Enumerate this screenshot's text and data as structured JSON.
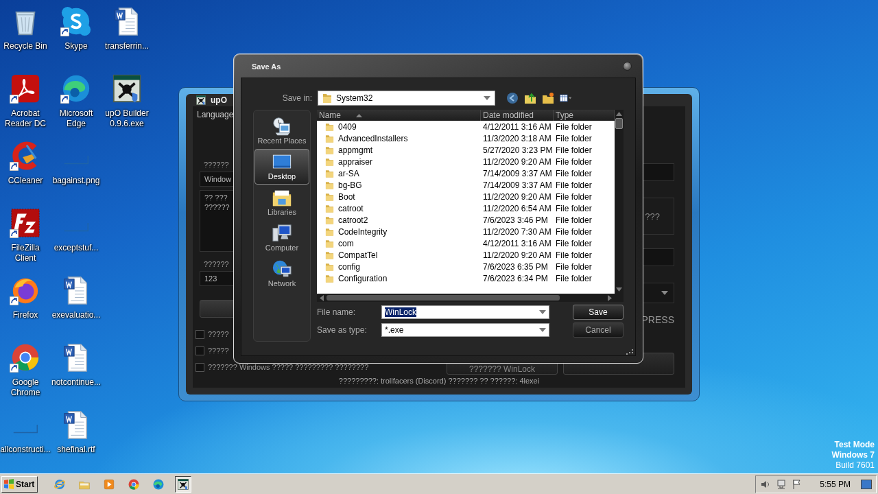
{
  "desktop": {
    "icon_columns": [
      [
        {
          "label": "Recycle Bin",
          "kind": "recycle-bin",
          "shortcut": false
        },
        {
          "label": "Acrobat Reader DC",
          "kind": "acrobat",
          "shortcut": true
        },
        {
          "label": "CCleaner",
          "kind": "ccleaner",
          "shortcut": true
        },
        {
          "label": "FileZilla Client",
          "kind": "filezilla",
          "shortcut": true
        },
        {
          "label": "Firefox",
          "kind": "firefox",
          "shortcut": true
        },
        {
          "label": "Google Chrome",
          "kind": "chrome",
          "shortcut": true
        },
        {
          "label": "allconstructi...",
          "kind": "blank",
          "shortcut": false
        }
      ],
      [
        {
          "label": "Skype",
          "kind": "skype",
          "shortcut": true
        },
        {
          "label": "Microsoft Edge",
          "kind": "edge",
          "shortcut": true
        },
        {
          "label": "bagainst.png",
          "kind": "blank",
          "shortcut": false
        },
        {
          "label": "exceptstuf...",
          "kind": "blank",
          "shortcut": false
        },
        {
          "label": "exevaluatio...",
          "kind": "word-doc",
          "shortcut": false
        },
        {
          "label": "notcontinue...",
          "kind": "word-doc",
          "shortcut": false
        },
        {
          "label": "shefinal.rtf",
          "kind": "word-doc",
          "shortcut": false
        }
      ],
      [
        {
          "label": "transferrin...",
          "kind": "word-doc",
          "shortcut": false
        },
        {
          "label": "upO Builder 0.9.6.exe",
          "kind": "app-exe",
          "shortcut": false
        }
      ]
    ]
  },
  "background_window": {
    "title": "upO",
    "menu": [
      "Language"
    ],
    "left_panel": {
      "group_label": "??????",
      "name_field": "Window",
      "message_lines": [
        "?? ???",
        "??????"
      ],
      "code_label": "??????",
      "code_field": "123",
      "checkboxes": [
        {
          "label": "?????",
          "checked": false
        },
        {
          "label": "?????",
          "checked": false
        },
        {
          "label": "??????? Windows ????? ????????? ????????",
          "checked": false
        }
      ]
    },
    "right_panel": {
      "button_label": "???",
      "format_text": "PRESS",
      "build_button": "??????? WinLock"
    },
    "status": "?????????: trollfacers (Discord) ??????? ?? ??????: 4lexei"
  },
  "save_dialog": {
    "title": "Save As",
    "save_in_label": "Save in:",
    "save_in": "System32",
    "places": [
      {
        "label": "Recent Places",
        "kind": "recent",
        "selected": false
      },
      {
        "label": "Desktop",
        "kind": "desktop",
        "selected": true
      },
      {
        "label": "Libraries",
        "kind": "libraries",
        "selected": false
      },
      {
        "label": "Computer",
        "kind": "computer",
        "selected": false
      },
      {
        "label": "Network",
        "kind": "network",
        "selected": false
      }
    ],
    "columns": [
      "Name",
      "Date modified",
      "Type"
    ],
    "files": [
      {
        "name": "0409",
        "date": "4/12/2011 3:16 AM",
        "type": "File folder"
      },
      {
        "name": "AdvancedInstallers",
        "date": "11/3/2020 3:18 AM",
        "type": "File folder"
      },
      {
        "name": "appmgmt",
        "date": "5/27/2020 3:23 PM",
        "type": "File folder"
      },
      {
        "name": "appraiser",
        "date": "11/2/2020 9:20 AM",
        "type": "File folder"
      },
      {
        "name": "ar-SA",
        "date": "7/14/2009 3:37 AM",
        "type": "File folder"
      },
      {
        "name": "bg-BG",
        "date": "7/14/2009 3:37 AM",
        "type": "File folder"
      },
      {
        "name": "Boot",
        "date": "11/2/2020 9:20 AM",
        "type": "File folder"
      },
      {
        "name": "catroot",
        "date": "11/2/2020 6:54 AM",
        "type": "File folder"
      },
      {
        "name": "catroot2",
        "date": "7/6/2023 3:46 PM",
        "type": "File folder"
      },
      {
        "name": "CodeIntegrity",
        "date": "11/2/2020 7:30 AM",
        "type": "File folder"
      },
      {
        "name": "com",
        "date": "4/12/2011 3:16 AM",
        "type": "File folder"
      },
      {
        "name": "CompatTel",
        "date": "11/2/2020 9:20 AM",
        "type": "File folder"
      },
      {
        "name": "config",
        "date": "7/6/2023 6:35 PM",
        "type": "File folder"
      },
      {
        "name": "Configuration",
        "date": "7/6/2023 6:34 PM",
        "type": "File folder"
      }
    ],
    "file_name_label": "File name:",
    "file_name": "WinLock",
    "file_name_selected": true,
    "type_label": "Save as type:",
    "type": "*.exe",
    "buttons": [
      "Save",
      "Cancel"
    ]
  },
  "taskbar": {
    "start": "Start",
    "apps": [
      {
        "kind": "ie",
        "active": false
      },
      {
        "kind": "explorer",
        "active": false
      },
      {
        "kind": "media",
        "active": false
      },
      {
        "kind": "chrome",
        "active": false
      },
      {
        "kind": "edge",
        "active": false
      },
      {
        "kind": "app-exe",
        "active": true
      }
    ],
    "clock": "5:55 PM"
  },
  "os_watermark": [
    "Test Mode",
    "Windows 7",
    "Build 7601"
  ]
}
